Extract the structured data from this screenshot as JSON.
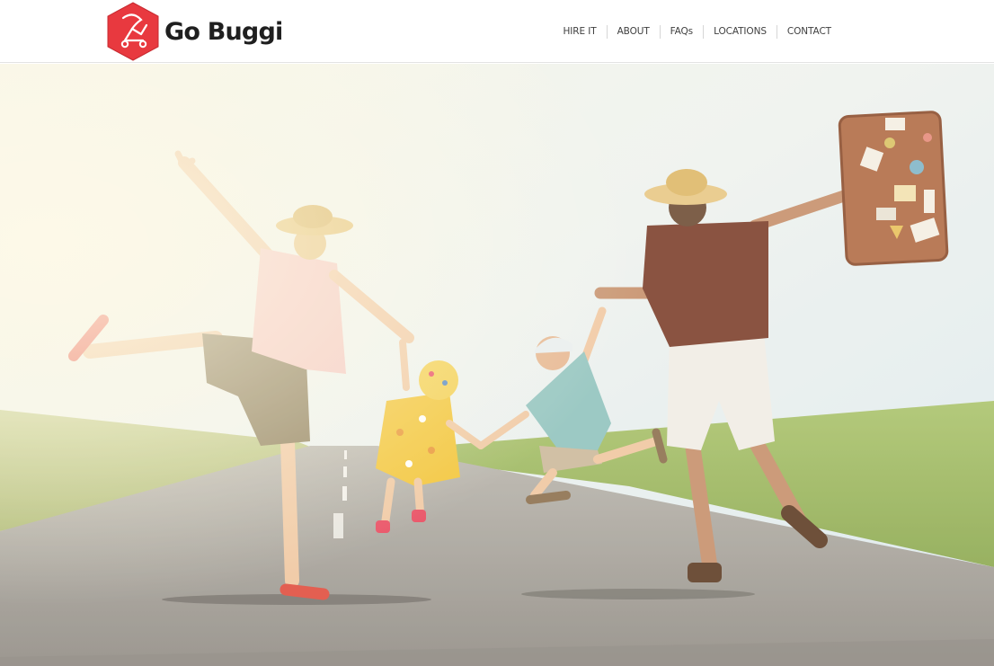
{
  "brand": {
    "name": "Go Buggi",
    "accent_color": "#e8393f",
    "logo_icon": "buggy-icon"
  },
  "nav": {
    "items": [
      {
        "label": "HIRE IT"
      },
      {
        "label": "ABOUT"
      },
      {
        "label": "FAQs"
      },
      {
        "label": "LOCATIONS"
      },
      {
        "label": "CONTACT"
      }
    ]
  },
  "hero": {
    "image": "family-jumping-on-road-photo",
    "colors": {
      "sky": "#eef3f0",
      "grass": "#9cb85a",
      "road": "#9d9a93"
    }
  }
}
